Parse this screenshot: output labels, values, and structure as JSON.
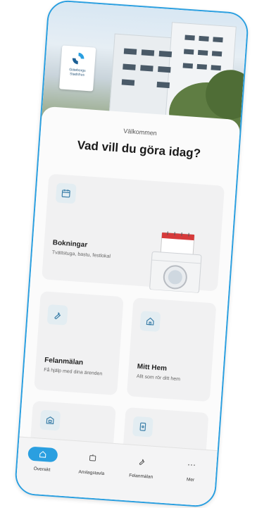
{
  "hero": {
    "logo_text_line1": "Göteborgs",
    "logo_text_line2": "Stadshus"
  },
  "welcome": "Välkommen",
  "title": "Vad vill du göra idag?",
  "cards": {
    "bookings": {
      "title": "Bokningar",
      "subtitle": "Tvättstuga, bastu, festlokal"
    },
    "report": {
      "title": "Felanmälan",
      "subtitle": "Få hjälp med dina ärenden"
    },
    "home": {
      "title": "Mitt Hem",
      "subtitle": "Allt som rör ditt hem"
    }
  },
  "nav": {
    "items": [
      {
        "label": "Översikt",
        "icon": "home-icon"
      },
      {
        "label": "Anslagstavla",
        "icon": "noticeboard-icon"
      },
      {
        "label": "Felanmälan",
        "icon": "wrench-icon"
      },
      {
        "label": "Mer",
        "icon": "more-icon"
      }
    ]
  },
  "colors": {
    "accent": "#2a9fe0"
  }
}
